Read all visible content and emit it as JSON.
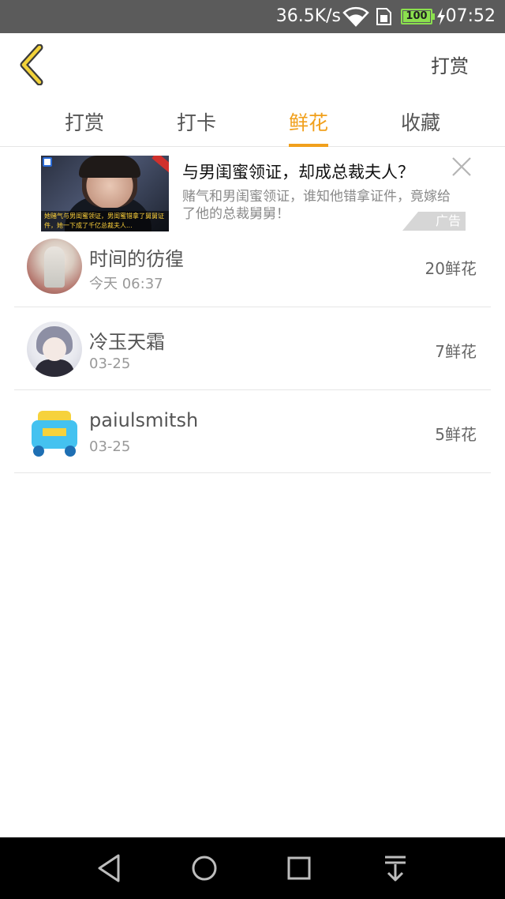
{
  "status_bar": {
    "network_speed": "36.5K/s",
    "battery_level": "100",
    "time": "07:52"
  },
  "header": {
    "action_label": "打赏"
  },
  "tabs": [
    {
      "label": "打赏",
      "active": false
    },
    {
      "label": "打卡",
      "active": false
    },
    {
      "label": "鲜花",
      "active": true
    },
    {
      "label": "收藏",
      "active": false
    }
  ],
  "ad": {
    "title": "与男闺蜜领证，却成总裁夫人？",
    "description": "赌气和男闺蜜领证，谁知他错拿证件，竟嫁给了他的总裁舅舅！",
    "image_caption": "她赌气与男闺蜜领证，男闺蜜错拿了舅舅证件，她一下成了千亿总裁夫人...",
    "tag": "广告"
  },
  "list": [
    {
      "name": "时间的彷徨",
      "date": "今天 06:37",
      "flowers": "20鲜花"
    },
    {
      "name": "冷玉天霜",
      "date": "03-25",
      "flowers": "7鲜花"
    },
    {
      "name": "paiulsmitsh",
      "date": "03-25",
      "flowers": "5鲜花"
    }
  ],
  "colors": {
    "accent": "#f1a01c",
    "status_bar": "#5b5b5b",
    "nav_bar": "#000000"
  },
  "icons": {
    "back": "chevron-left-icon",
    "ad_close": "close-icon",
    "nav_back": "triangle-back-icon",
    "nav_home": "circle-home-icon",
    "nav_recent": "square-recent-icon",
    "nav_notifications": "pull-down-icon"
  }
}
